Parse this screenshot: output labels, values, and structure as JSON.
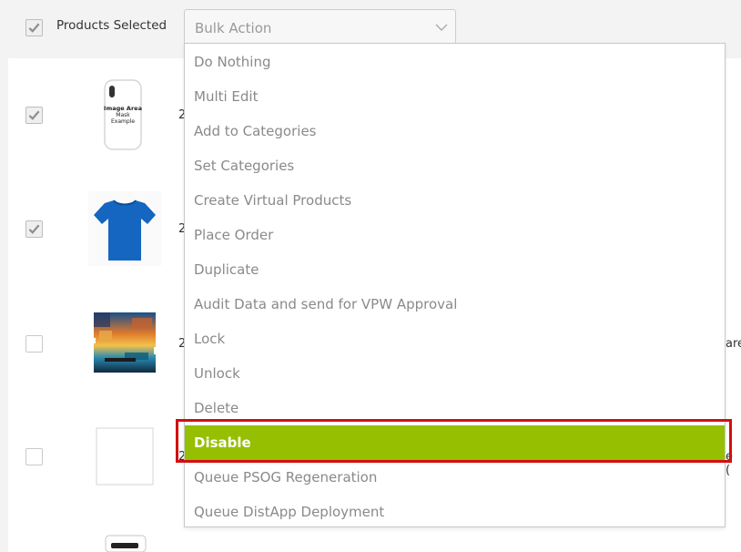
{
  "header": {
    "select_all_checked": true,
    "selected_label": "Products Selected",
    "bulk_action_placeholder": "Bulk Action"
  },
  "rows": [
    {
      "checked": true,
      "thumb": "phone-case-image",
      "thumb_text": "Image Area Mask Example",
      "stub": "2"
    },
    {
      "checked": true,
      "thumb": "blue-tshirt-image",
      "stub": "2"
    },
    {
      "checked": false,
      "thumb": "sunset-art-image",
      "stub": "2",
      "trailing": "are"
    },
    {
      "checked": false,
      "thumb": "blank-product-image",
      "stub": "2",
      "trailing": "e ("
    },
    {
      "checked": false,
      "thumb": "device-image"
    }
  ],
  "dropdown": {
    "options": [
      "Do Nothing",
      "Multi Edit",
      "Add to Categories",
      "Set Categories",
      "Create Virtual Products",
      "Place Order",
      "Duplicate",
      "Audit Data and send for VPW Approval",
      "Lock",
      "Unlock",
      "Delete",
      "Disable",
      "Queue PSOG Regeneration",
      "Queue DistApp Deployment"
    ],
    "highlighted": "Disable"
  },
  "colors": {
    "highlight_green": "#95bf00",
    "annotation_red": "#d20f0f",
    "option_text": "#8a8a8a"
  }
}
